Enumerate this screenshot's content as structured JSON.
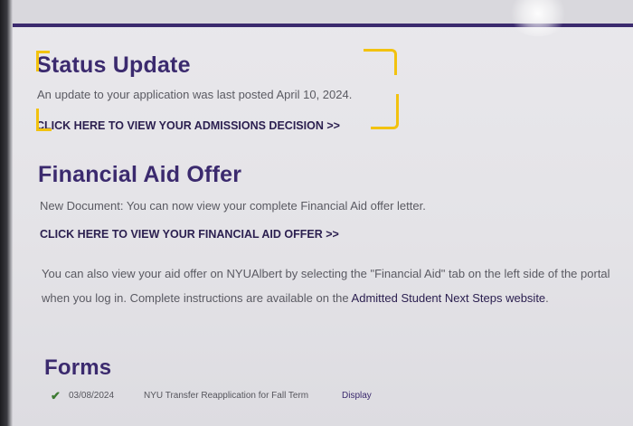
{
  "status_update": {
    "heading": "Status Update",
    "message": "An update to your application was last posted April 10, 2024.",
    "decision_link": "CLICK HERE TO VIEW YOUR ADMISSIONS DECISION >>"
  },
  "financial_aid": {
    "heading": "Financial Aid Offer",
    "new_document": "New Document: You can now view your complete Financial Aid offer letter.",
    "offer_link": "CLICK HERE TO VIEW YOUR FINANCIAL AID OFFER >>",
    "info_text": "You can also view your aid offer on NYUAlbert by selecting the \"Financial Aid\" tab on the left side of the portal when you log in. Complete instructions are available on the ",
    "next_steps_link": "Admitted Student Next Steps website",
    "info_end": "."
  },
  "forms": {
    "heading": "Forms",
    "items": [
      {
        "date": "03/08/2024",
        "name": "NYU Transfer Reapplication for Fall Term",
        "action": "Display"
      }
    ]
  },
  "colors": {
    "brand_purple": "#3b2a6e",
    "highlight_yellow": "#f2c20f",
    "check_green": "#3d7a32"
  }
}
